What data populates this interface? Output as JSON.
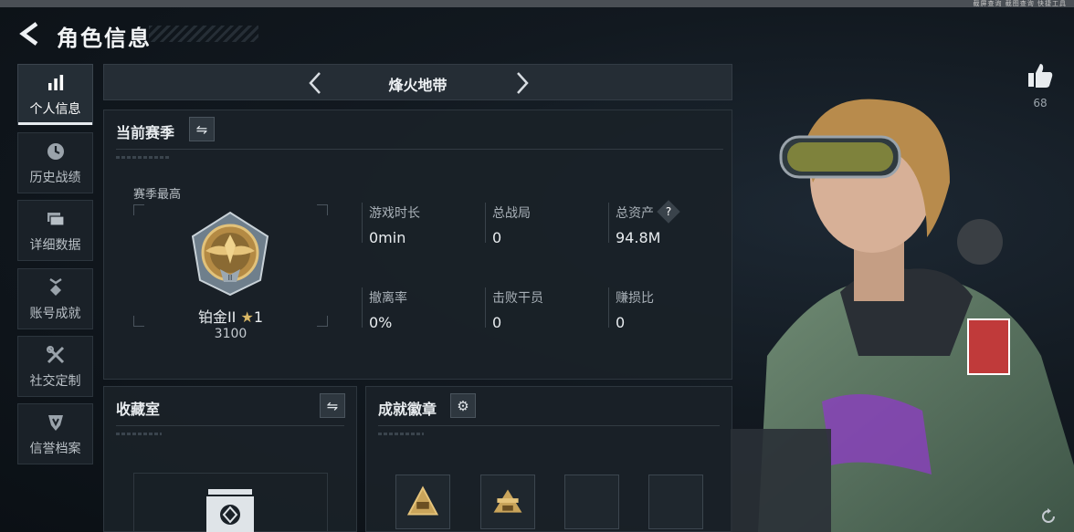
{
  "system_bar_text": "截屏查询  截图查询  快捷工具",
  "header": {
    "title": "角色信息"
  },
  "sidebar": {
    "items": [
      {
        "label": "个人信息",
        "icon": "bar-chart-icon",
        "active": true
      },
      {
        "label": "历史战绩",
        "icon": "clock-icon",
        "active": false
      },
      {
        "label": "详细数据",
        "icon": "folder-icon",
        "active": false
      },
      {
        "label": "账号成就",
        "icon": "medal-icon",
        "active": false
      },
      {
        "label": "社交定制",
        "icon": "tools-icon",
        "active": false
      },
      {
        "label": "信誉档案",
        "icon": "shield-icon",
        "active": false
      }
    ]
  },
  "mode": {
    "name": "烽火地带"
  },
  "season": {
    "title": "当前赛季",
    "peak_label": "赛季最高",
    "rank_name": "铂金II",
    "rank_stars": "1",
    "rank_score": "3100",
    "stats": [
      {
        "label": "游戏时长",
        "value": "0min"
      },
      {
        "label": "总战局",
        "value": "0"
      },
      {
        "label": "总资产",
        "value": "94.8M",
        "help": "?"
      },
      {
        "label": "撤离率",
        "value": "0%"
      },
      {
        "label": "击败干员",
        "value": "0"
      },
      {
        "label": "赚损比",
        "value": "0"
      }
    ]
  },
  "collection": {
    "title": "收藏室"
  },
  "badges": {
    "title": "成就徽章"
  },
  "likes": {
    "count": "68"
  },
  "colors": {
    "accent_gold": "#c9a45a",
    "panel_bg": "#1a2128",
    "text": "#e8ecef"
  }
}
